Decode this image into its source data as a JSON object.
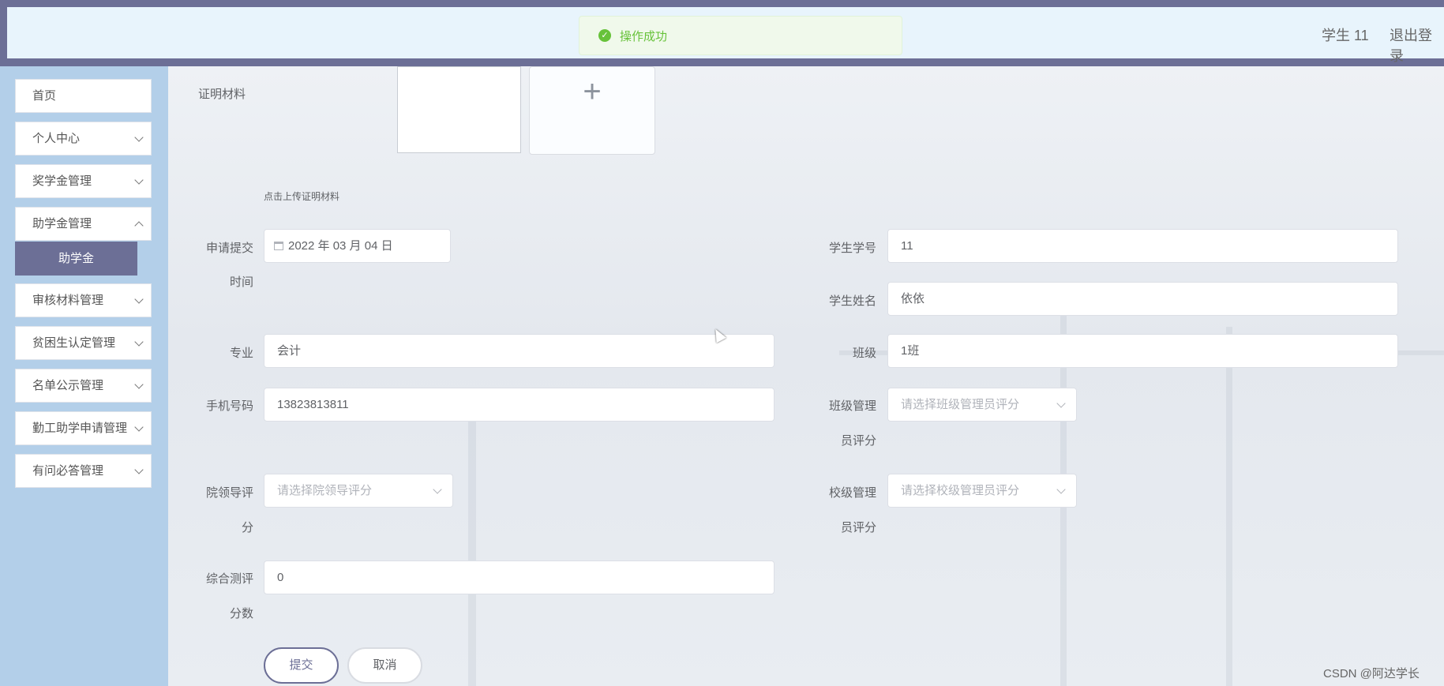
{
  "header": {
    "user": "学生 11",
    "logout": "退出登录",
    "toast": "操作成功"
  },
  "sidebar": {
    "items": [
      {
        "label": "首页"
      },
      {
        "label": "个人中心"
      },
      {
        "label": "奖学金管理"
      },
      {
        "label": "助学金管理"
      },
      {
        "label": "审核材料管理"
      },
      {
        "label": "贫困生认定管理"
      },
      {
        "label": "名单公示管理"
      },
      {
        "label": "勤工助学申请管理"
      },
      {
        "label": "有问必答管理"
      }
    ],
    "active_sub": "助学金"
  },
  "form": {
    "proof_label": "证明材料",
    "upload_plus": "+",
    "upload_hint": "点击上传证明材料",
    "submit_time_label_1": "申请提交",
    "submit_time_label_2": "时间",
    "submit_time_value": "2022 年 03 月 04 日",
    "student_no_label": "学生学号",
    "student_no_value": "11",
    "student_name_label": "学生姓名",
    "student_name_value": "依依",
    "major_label": "专业",
    "major_value": "会计",
    "class_label": "班级",
    "class_value": "1班",
    "phone_label": "手机号码",
    "phone_value": "13823813811",
    "class_mgr_label_1": "班级管理",
    "class_mgr_label_2": "员评分",
    "class_mgr_placeholder": "请选择班级管理员评分",
    "college_label_1": "院领导评",
    "college_label_2": "分",
    "college_placeholder": "请选择院领导评分",
    "school_mgr_label_1": "校级管理",
    "school_mgr_label_2": "员评分",
    "school_mgr_placeholder": "请选择校级管理员评分",
    "score_label_1": "综合测评",
    "score_label_2": "分数",
    "score_value": "0",
    "submit": "提交",
    "cancel": "取消"
  },
  "watermark": "CSDN @阿达学长",
  "colors": {
    "accent": "#6c6f96",
    "sidebar_bg": "#b3cfe9",
    "topbar_inner": "#e8f4fc",
    "success": "#67c23a"
  }
}
